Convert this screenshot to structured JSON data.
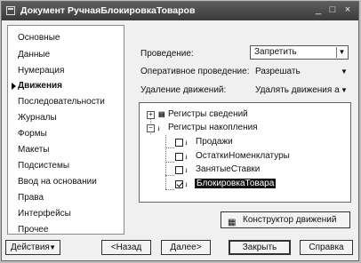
{
  "window": {
    "title": "Документ РучнаяБлокировкаТоваров",
    "controls": {
      "minimize": "_",
      "maximize": "□",
      "close": "×"
    }
  },
  "nav": {
    "items": [
      {
        "label": "Основные",
        "active": false
      },
      {
        "label": "Данные",
        "active": false
      },
      {
        "label": "Нумерация",
        "active": false
      },
      {
        "label": "Движения",
        "active": true
      },
      {
        "label": "Последовательности",
        "active": false
      },
      {
        "label": "Журналы",
        "active": false
      },
      {
        "label": "Формы",
        "active": false
      },
      {
        "label": "Макеты",
        "active": false
      },
      {
        "label": "Подсистемы",
        "active": false
      },
      {
        "label": "Ввод на основании",
        "active": false
      },
      {
        "label": "Права",
        "active": false
      },
      {
        "label": "Интерфейсы",
        "active": false
      },
      {
        "label": "Прочее",
        "active": false
      }
    ]
  },
  "form": {
    "posting": {
      "label": "Проведение:",
      "value": "Запретить"
    },
    "realtime_posting": {
      "label": "Оперативное проведение:",
      "value": "Разрешать"
    },
    "delete_movements": {
      "label": "Удаление движений:",
      "value": "Удалять движения а"
    }
  },
  "tree": {
    "root1": {
      "label": "Регистры сведений",
      "expander": "+"
    },
    "root2": {
      "label": "Регистры накопления",
      "expander": "−"
    },
    "children": [
      {
        "label": "Продажи",
        "checked": false
      },
      {
        "label": "ОстаткиНоменклатуры",
        "checked": false
      },
      {
        "label": "ЗанятыеСтавки",
        "checked": false
      },
      {
        "label": "БлокировкаТовара",
        "checked": true,
        "selected": true
      }
    ]
  },
  "buttons": {
    "constructor": "Конструктор движений",
    "actions": "Действия",
    "back": "<Назад",
    "next": "Далее>",
    "close": "Закрыть",
    "help": "Справка"
  }
}
